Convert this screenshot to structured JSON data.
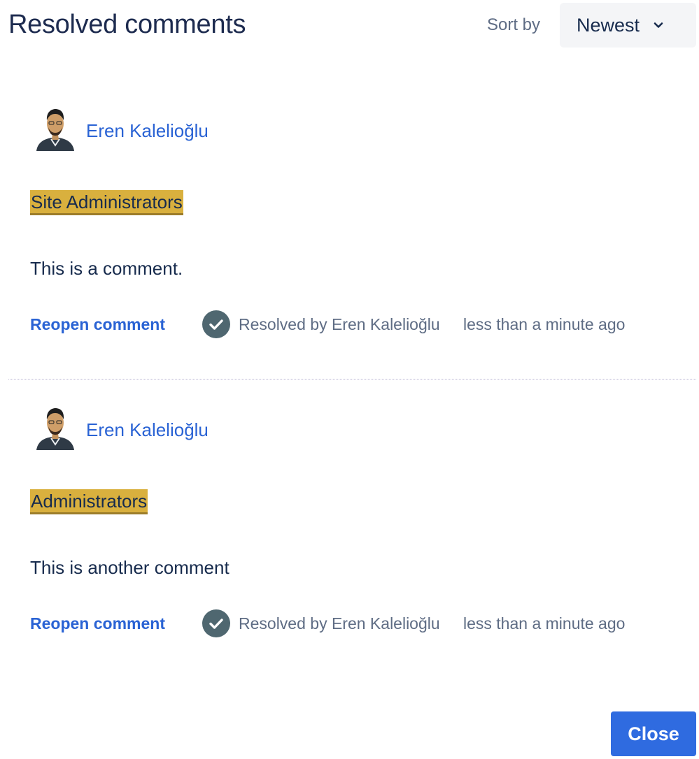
{
  "header": {
    "title": "Resolved comments",
    "sort_label": "Sort by",
    "sort_value": "Newest"
  },
  "comments": [
    {
      "author": "Eren Kalelioğlu",
      "highlighted_text": "Site Administrators",
      "body": "This is a comment.",
      "reopen_label": "Reopen comment",
      "resolved_by": "Resolved by Eren Kalelioğlu",
      "resolved_time": "less than a minute ago"
    },
    {
      "author": "Eren Kalelioğlu",
      "highlighted_text": "Administrators",
      "body": "This is another comment",
      "reopen_label": "Reopen comment",
      "resolved_by": "Resolved by Eren Kalelioğlu",
      "resolved_time": "less than a minute ago"
    }
  ],
  "footer": {
    "close_label": "Close"
  },
  "icons": {
    "sort_chevron": "chevron-down-icon",
    "resolved": "check-circle-icon",
    "avatar": "user-avatar"
  },
  "colors": {
    "link": "#2a63d4",
    "highlight": "#d9b03e",
    "primary_button": "#2f6be0",
    "resolved_icon": "#4f6770"
  }
}
